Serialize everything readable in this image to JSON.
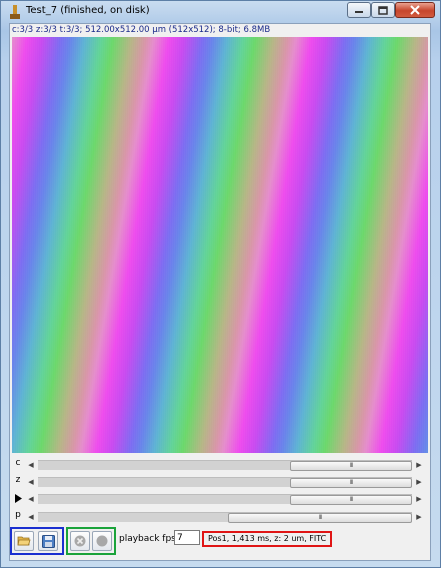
{
  "window": {
    "title": "Test_7 (finished, on disk)",
    "controls": {
      "minimize": "minimize-icon",
      "maximize": "maximize-icon",
      "close": "close-icon"
    }
  },
  "image_info": "c:3/3 z:3/3 t:3/3; 512.00x512.00 µm (512x512); 8-bit; 6.8MB",
  "sliders": [
    {
      "label": "c",
      "icon": null,
      "thumb": "III",
      "position": 0.85
    },
    {
      "label": "z",
      "icon": null,
      "thumb": "III",
      "position": 0.85
    },
    {
      "label": "",
      "icon": "play-icon",
      "thumb": "III",
      "position": 0.85
    },
    {
      "label": "p",
      "icon": null,
      "thumb": "III",
      "position": 0.64
    }
  ],
  "toolbar": {
    "open_icon": "folder-open-icon",
    "save_icon": "save-icon",
    "abort_icon": "abort-icon",
    "record_icon": "record-icon",
    "fps_label": "playback fps:",
    "fps_value": "7"
  },
  "status_text": "Pos1, 1,413 ms, z: 2 um, FITC",
  "colors": {
    "blue_group": "#1a2fd0",
    "green_group": "#1aa33a",
    "status_border": "#e01515"
  }
}
